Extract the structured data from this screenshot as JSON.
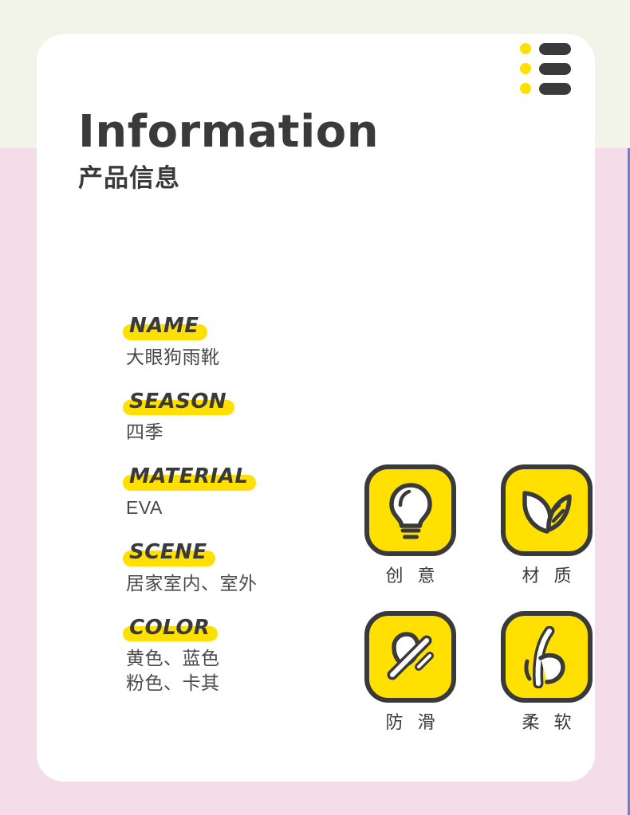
{
  "page": {
    "bg_cream": "#f2f3e9",
    "bg_pink": "#f4dde9",
    "card_bg": "#ffffff",
    "accent_yellow": "#ffe000",
    "ink": "#3a3a3a"
  },
  "header": {
    "title_en": "Information",
    "title_cn": "产品信息",
    "menu_icon": "list-icon"
  },
  "specs": [
    {
      "key": "NAME",
      "values": [
        "大眼狗雨靴"
      ]
    },
    {
      "key": "SEASON",
      "values": [
        "四季"
      ]
    },
    {
      "key": "MATERIAL",
      "values": [
        "EVA"
      ]
    },
    {
      "key": "SCENE",
      "values": [
        "居家室内、室外"
      ]
    },
    {
      "key": "COLOR",
      "values": [
        "黄色、蓝色",
        "粉色、卡其"
      ]
    }
  ],
  "features": [
    {
      "label": "创 意",
      "icon": "lightbulb-icon"
    },
    {
      "label": "材 质",
      "icon": "leaf-icon"
    },
    {
      "label": "防 滑",
      "icon": "anti-slip-icon"
    },
    {
      "label": "柔 软",
      "icon": "flexible-icon"
    }
  ]
}
